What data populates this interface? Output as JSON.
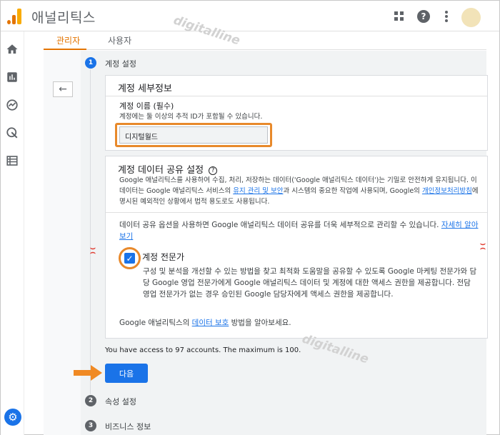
{
  "app": {
    "title": "애널리틱스"
  },
  "tabs": [
    {
      "label": "관리자",
      "active": true
    },
    {
      "label": "사용자",
      "active": false
    }
  ],
  "steps": [
    {
      "number": "1",
      "label": "계정 설정"
    },
    {
      "number": "2",
      "label": "속성 설정"
    },
    {
      "number": "3",
      "label": "비즈니스 정보"
    }
  ],
  "account_details": {
    "title": "계정 세부정보",
    "name_label": "계정 이름 (필수)",
    "name_help": "계정에는 둘 이상의 추적 ID가 포함될 수 있습니다.",
    "name_value": "디지털월드"
  },
  "data_sharing": {
    "title": "계정 데이터 공유 설정",
    "desc_part1": "Google 애널리틱스를 사용하여 수집, 처리, 저장하는 데이터('Google 애널리틱스 데이터')는 기밀로 안전하게 유지됩니다. 이 데이터는 Google 애널리틱스 서비스의 ",
    "desc_link1": "유지 관리 및 보안",
    "desc_part2": "과 시스템의 중요한 작업에 사용되며, Google의 ",
    "desc_link2": "개인정보처리방침",
    "desc_part3": "에 명시된 예외적인 상황에서 법적 용도로도 사용됩니다.",
    "options_text": "데이터 공유 옵션을 사용하면 Google 애널리틱스 데이터 공유를 더욱 세부적으로 관리할 수 있습니다. ",
    "options_link": "자세히 알아보기",
    "expert_title": "계정 전문가",
    "expert_desc": "구성 및 분석을 개선할 수 있는 방법을 찾고 최적화 도움말을 공유할 수 있도록 Google 마케팅 전문가와 담당 Google 영업 전문가에게 Google 애널리틱스 데이터 및 계정에 대한 액세스 권한을 제공합니다. 전담 영업 전문가가 없는 경우 승인된 Google 담당자에게 액세스 권한을 제공합니다.",
    "expert_checked": true,
    "protect_part1": "Google 애널리틱스의 ",
    "protect_link": "데이터 보호",
    "protect_part2": " 방법을 알아보세요."
  },
  "notice": "You have access to 97 accounts. The maximum is 100.",
  "next_button": "다음",
  "watermark": "digitalline",
  "colors": {
    "accent": "#1a73e8",
    "brand": "#e37400",
    "highlight": "#e8892b"
  }
}
